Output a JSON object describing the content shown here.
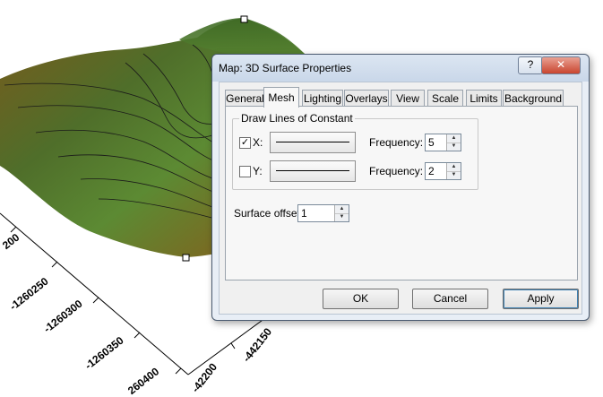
{
  "dialog": {
    "title": "Map: 3D Surface Properties",
    "help_glyph": "?",
    "close_glyph": "✕"
  },
  "tabs": [
    {
      "label": "General"
    },
    {
      "label": "Mesh",
      "active": true
    },
    {
      "label": "Lighting"
    },
    {
      "label": "Overlays"
    },
    {
      "label": "View"
    },
    {
      "label": "Scale"
    },
    {
      "label": "Limits"
    },
    {
      "label": "Background"
    }
  ],
  "mesh": {
    "group_title": "Draw Lines of Constant",
    "x": {
      "label": "X:",
      "checked": true,
      "check_glyph": "✓",
      "frequency_label": "Frequency:",
      "frequency": "5"
    },
    "y": {
      "label": "Y:",
      "checked": false,
      "check_glyph": "",
      "frequency_label": "Frequency:",
      "frequency": "2"
    },
    "surface_offset_label": "Surface offset:",
    "surface_offset": "1"
  },
  "buttons": {
    "ok": "OK",
    "cancel": "Cancel",
    "apply": "Apply"
  },
  "plot": {
    "axis_labels_left": [
      "200",
      "-1260250",
      "-1260300",
      "-1260350",
      "260400"
    ],
    "axis_labels_right": [
      "-42200",
      "-442150"
    ],
    "colors": {
      "surface_green": "#4d7a2c",
      "surface_brown": "#6b3d14",
      "contour": "#1a1a1a"
    }
  }
}
